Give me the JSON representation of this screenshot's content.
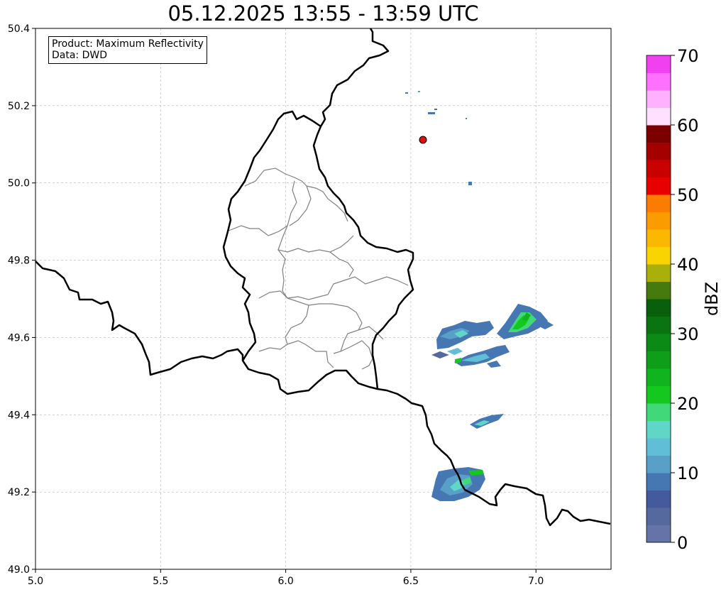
{
  "title": "05.12.2025 13:55 - 13:59 UTC",
  "info": {
    "product": "Product: Maximum Reflectivity",
    "source": "Data: DWD"
  },
  "map": {
    "lon_range": [
      5.0,
      7.3
    ],
    "lat_range": [
      49.0,
      50.4
    ],
    "x_ticks": [
      "5.0",
      "5.5",
      "6.0",
      "6.5",
      "7.0"
    ],
    "x_tick_values": [
      5.0,
      5.5,
      6.0,
      6.5,
      7.0
    ],
    "y_ticks": [
      "49.0",
      "49.2",
      "49.4",
      "49.6",
      "49.8",
      "50.0",
      "50.2",
      "50.4"
    ],
    "y_tick_values": [
      49.0,
      49.2,
      49.4,
      49.6,
      49.8,
      50.0,
      50.2,
      50.4
    ],
    "grid": true,
    "marker": {
      "lon": 6.545,
      "lat": 50.11,
      "color": "#e01010"
    },
    "border_color": "#000000",
    "district_color": "#808080"
  },
  "colorbar": {
    "label": "dBZ",
    "ticks": [
      "0",
      "10",
      "20",
      "30",
      "40",
      "50",
      "60",
      "70"
    ],
    "tick_values": [
      0,
      10,
      20,
      30,
      40,
      50,
      60,
      70
    ],
    "colors": [
      "#6474a8",
      "#56699f",
      "#455a9c",
      "#4777b2",
      "#58a0c8",
      "#60bfd6",
      "#60d6c8",
      "#40d878",
      "#14c81e",
      "#10b41e",
      "#0e9e1a",
      "#0c8a16",
      "#0a7410",
      "#08600c",
      "#467a0e",
      "#aab00a",
      "#fad400",
      "#fab800",
      "#fa9c00",
      "#fa7c00",
      "#e80000",
      "#c80000",
      "#a40000",
      "#7c0000",
      "#ffe0ff",
      "#ffb0ff",
      "#ff70ff",
      "#f040f0"
    ]
  }
}
